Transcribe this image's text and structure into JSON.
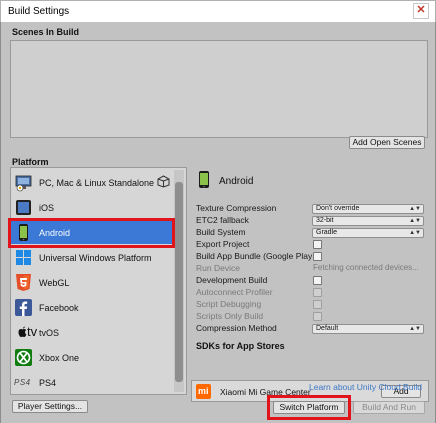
{
  "window": {
    "title": "Build Settings",
    "close_glyph": "✕"
  },
  "scenes": {
    "header": "Scenes In Build",
    "add_open_scenes": "Add Open Scenes"
  },
  "platform": {
    "header": "Platform",
    "items": [
      {
        "label": "PC, Mac & Linux Standalone",
        "icon": "pc-mac-linux-icon"
      },
      {
        "label": "iOS",
        "icon": "ios-icon"
      },
      {
        "label": "Android",
        "icon": "android-icon",
        "selected": true
      },
      {
        "label": "Universal Windows Platform",
        "icon": "windows-icon"
      },
      {
        "label": "WebGL",
        "icon": "html5-icon"
      },
      {
        "label": "Facebook",
        "icon": "facebook-icon"
      },
      {
        "label": "tvOS",
        "icon": "tvos-icon"
      },
      {
        "label": "Xbox One",
        "icon": "xbox-icon"
      },
      {
        "label": "PS4",
        "icon": "ps4-icon"
      }
    ],
    "tv_text": "tv",
    "ps4_logo": "PS4"
  },
  "settings": {
    "platform_name": "Android",
    "texture_compression": {
      "label": "Texture Compression",
      "value": "Don't override"
    },
    "etc2_fallback": {
      "label": "ETC2 fallback",
      "value": "32-bit"
    },
    "build_system": {
      "label": "Build System",
      "value": "Gradle"
    },
    "export_project": {
      "label": "Export Project"
    },
    "build_app_bundle": {
      "label": "Build App Bundle (Google Play)"
    },
    "run_device": {
      "label": "Run Device",
      "value": "Fetching connected devices..."
    },
    "development_build": {
      "label": "Development Build"
    },
    "autoconnect_profiler": {
      "label": "Autoconnect Profiler"
    },
    "script_debugging": {
      "label": "Script Debugging"
    },
    "scripts_only_build": {
      "label": "Scripts Only Build"
    },
    "compression_method": {
      "label": "Compression Method",
      "value": "Default"
    }
  },
  "sdks": {
    "header": "SDKs for App Stores",
    "item": "Xiaomi Mi Game Center",
    "logo_text": "mi",
    "add": "Add"
  },
  "footer": {
    "cloud_link": "Learn about Unity Cloud Build",
    "player_settings": "Player Settings...",
    "switch_platform": "Switch Platform",
    "build_and_run": "Build And Run"
  },
  "colors": {
    "selection": "#3c79d6",
    "highlight_box": "#e0141a",
    "link": "#3d78c7"
  }
}
